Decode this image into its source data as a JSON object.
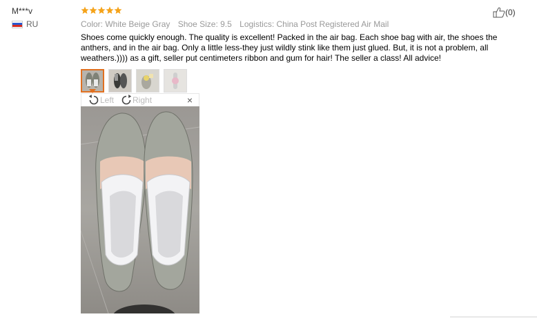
{
  "reviewer": {
    "name": "M***v",
    "country_code": "RU",
    "flag_colors": [
      "#ffffff",
      "#2a5ad0",
      "#d52b1e"
    ]
  },
  "review": {
    "rating": 5,
    "star_color": "#f5a31a",
    "attributes": {
      "color": "Color: White Beige Gray",
      "shoe_size": "Shoe Size: 9.5",
      "logistics": "Logistics: China Post Registered Air Mail"
    },
    "text": "Shoes come quickly enough. The quality is excellent! Packed in the air bag. Each shoe bag with air, the shoes the anthers, and in the air bag. Only a little less-they just wildly stink like them just glued. But, it is not a problem, all weathers.)))) as a gift, seller put centimeters ribbon and gum for hair! The seller a class! All advice!",
    "helpful_count": "(0)"
  },
  "viewer": {
    "rotate_left": "Left",
    "rotate_right": "Right",
    "close": "×",
    "active_thumb_color": "#e07020"
  }
}
